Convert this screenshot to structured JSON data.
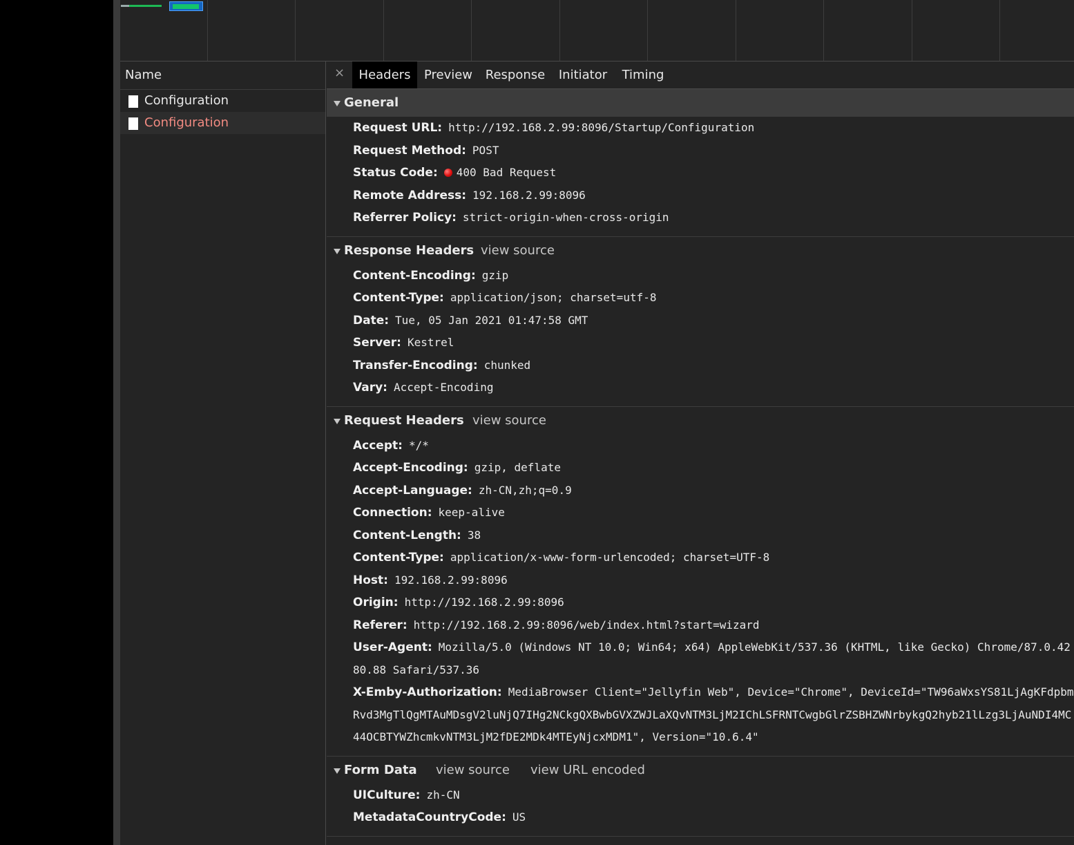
{
  "name_panel": {
    "header": "Name",
    "requests": [
      {
        "label": "Configuration",
        "status": "ok"
      },
      {
        "label": "Configuration",
        "status": "error"
      }
    ]
  },
  "tabs": {
    "close_symbol": "×",
    "items": [
      "Headers",
      "Preview",
      "Response",
      "Initiator",
      "Timing"
    ],
    "active": "Headers"
  },
  "general": {
    "title": "General",
    "rows": [
      {
        "key": "Request URL:",
        "value": "http://192.168.2.99:8096/Startup/Configuration"
      },
      {
        "key": "Request Method:",
        "value": "POST"
      },
      {
        "key": "Status Code:",
        "value": "400 Bad Request"
      },
      {
        "key": "Remote Address:",
        "value": "192.168.2.99:8096"
      },
      {
        "key": "Referrer Policy:",
        "value": "strict-origin-when-cross-origin"
      }
    ]
  },
  "response_headers": {
    "title": "Response Headers",
    "view_source": "view source",
    "rows": [
      {
        "key": "Content-Encoding:",
        "value": "gzip"
      },
      {
        "key": "Content-Type:",
        "value": "application/json; charset=utf-8"
      },
      {
        "key": "Date:",
        "value": "Tue, 05 Jan 2021 01:47:58 GMT"
      },
      {
        "key": "Server:",
        "value": "Kestrel"
      },
      {
        "key": "Transfer-Encoding:",
        "value": "chunked"
      },
      {
        "key": "Vary:",
        "value": "Accept-Encoding"
      }
    ]
  },
  "request_headers": {
    "title": "Request Headers",
    "view_source": "view source",
    "rows": [
      {
        "key": "Accept:",
        "value": "*/*"
      },
      {
        "key": "Accept-Encoding:",
        "value": "gzip, deflate"
      },
      {
        "key": "Accept-Language:",
        "value": "zh-CN,zh;q=0.9"
      },
      {
        "key": "Connection:",
        "value": "keep-alive"
      },
      {
        "key": "Content-Length:",
        "value": "38"
      },
      {
        "key": "Content-Type:",
        "value": "application/x-www-form-urlencoded; charset=UTF-8"
      },
      {
        "key": "Host:",
        "value": "192.168.2.99:8096"
      },
      {
        "key": "Origin:",
        "value": "http://192.168.2.99:8096"
      },
      {
        "key": "Referer:",
        "value": "http://192.168.2.99:8096/web/index.html?start=wizard"
      },
      {
        "key": "User-Agent:",
        "value": "Mozilla/5.0 (Windows NT 10.0; Win64; x64) AppleWebKit/537.36 (KHTML, like Gecko) Chrome/87.0.4280.88 Safari/537.36"
      },
      {
        "key": "X-Emby-Authorization:",
        "value": "MediaBrowser Client=\"Jellyfin Web\", Device=\"Chrome\", DeviceId=\"TW96aWxsYS81LjAgKFdpbmRvd3MgTlQgMTAuMDsgV2luNjQ7IHg2NCkgQXBwbGVXZWJLaXQvNTM3LjM2IChLSFRNTCwgbGlrZSBHZWNrbykgQ2hyb21lLzg3LjAuNDI4MC44OCBTYWZhcmkvNTM3LjM2fDE2MDk4MTEyNjcxMDM1\", Version=\"10.6.4\""
      }
    ]
  },
  "form_data": {
    "title": "Form Data",
    "view_source": "view source",
    "view_url_encoded": "view URL encoded",
    "rows": [
      {
        "key": "UICulture:",
        "value": "zh-CN"
      },
      {
        "key": "MetadataCountryCode:",
        "value": "US"
      }
    ]
  },
  "colors": {
    "status_error": "#e01010",
    "error_text": "#f28b82",
    "waterfall_green": "#13c46c",
    "waterfall_blue": "#1565c0"
  }
}
